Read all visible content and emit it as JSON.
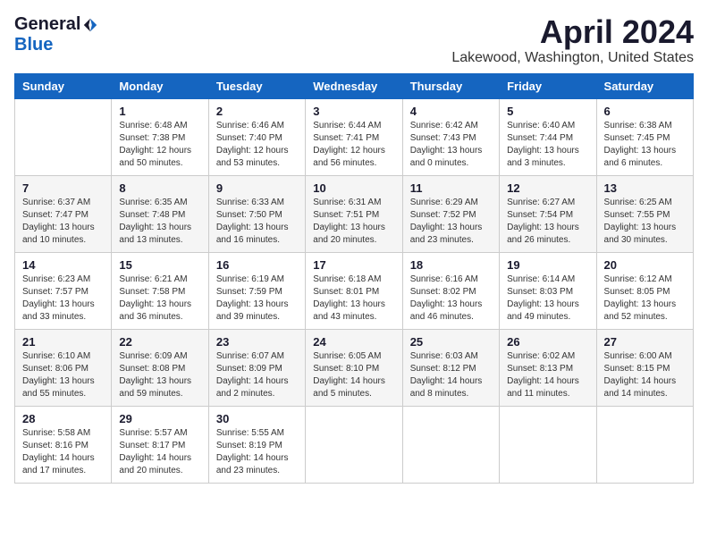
{
  "header": {
    "logo_general": "General",
    "logo_blue": "Blue",
    "month_title": "April 2024",
    "location": "Lakewood, Washington, United States"
  },
  "days_of_week": [
    "Sunday",
    "Monday",
    "Tuesday",
    "Wednesday",
    "Thursday",
    "Friday",
    "Saturday"
  ],
  "weeks": [
    [
      {
        "num": "",
        "info": ""
      },
      {
        "num": "1",
        "info": "Sunrise: 6:48 AM\nSunset: 7:38 PM\nDaylight: 12 hours\nand 50 minutes."
      },
      {
        "num": "2",
        "info": "Sunrise: 6:46 AM\nSunset: 7:40 PM\nDaylight: 12 hours\nand 53 minutes."
      },
      {
        "num": "3",
        "info": "Sunrise: 6:44 AM\nSunset: 7:41 PM\nDaylight: 12 hours\nand 56 minutes."
      },
      {
        "num": "4",
        "info": "Sunrise: 6:42 AM\nSunset: 7:43 PM\nDaylight: 13 hours\nand 0 minutes."
      },
      {
        "num": "5",
        "info": "Sunrise: 6:40 AM\nSunset: 7:44 PM\nDaylight: 13 hours\nand 3 minutes."
      },
      {
        "num": "6",
        "info": "Sunrise: 6:38 AM\nSunset: 7:45 PM\nDaylight: 13 hours\nand 6 minutes."
      }
    ],
    [
      {
        "num": "7",
        "info": "Sunrise: 6:37 AM\nSunset: 7:47 PM\nDaylight: 13 hours\nand 10 minutes."
      },
      {
        "num": "8",
        "info": "Sunrise: 6:35 AM\nSunset: 7:48 PM\nDaylight: 13 hours\nand 13 minutes."
      },
      {
        "num": "9",
        "info": "Sunrise: 6:33 AM\nSunset: 7:50 PM\nDaylight: 13 hours\nand 16 minutes."
      },
      {
        "num": "10",
        "info": "Sunrise: 6:31 AM\nSunset: 7:51 PM\nDaylight: 13 hours\nand 20 minutes."
      },
      {
        "num": "11",
        "info": "Sunrise: 6:29 AM\nSunset: 7:52 PM\nDaylight: 13 hours\nand 23 minutes."
      },
      {
        "num": "12",
        "info": "Sunrise: 6:27 AM\nSunset: 7:54 PM\nDaylight: 13 hours\nand 26 minutes."
      },
      {
        "num": "13",
        "info": "Sunrise: 6:25 AM\nSunset: 7:55 PM\nDaylight: 13 hours\nand 30 minutes."
      }
    ],
    [
      {
        "num": "14",
        "info": "Sunrise: 6:23 AM\nSunset: 7:57 PM\nDaylight: 13 hours\nand 33 minutes."
      },
      {
        "num": "15",
        "info": "Sunrise: 6:21 AM\nSunset: 7:58 PM\nDaylight: 13 hours\nand 36 minutes."
      },
      {
        "num": "16",
        "info": "Sunrise: 6:19 AM\nSunset: 7:59 PM\nDaylight: 13 hours\nand 39 minutes."
      },
      {
        "num": "17",
        "info": "Sunrise: 6:18 AM\nSunset: 8:01 PM\nDaylight: 13 hours\nand 43 minutes."
      },
      {
        "num": "18",
        "info": "Sunrise: 6:16 AM\nSunset: 8:02 PM\nDaylight: 13 hours\nand 46 minutes."
      },
      {
        "num": "19",
        "info": "Sunrise: 6:14 AM\nSunset: 8:03 PM\nDaylight: 13 hours\nand 49 minutes."
      },
      {
        "num": "20",
        "info": "Sunrise: 6:12 AM\nSunset: 8:05 PM\nDaylight: 13 hours\nand 52 minutes."
      }
    ],
    [
      {
        "num": "21",
        "info": "Sunrise: 6:10 AM\nSunset: 8:06 PM\nDaylight: 13 hours\nand 55 minutes."
      },
      {
        "num": "22",
        "info": "Sunrise: 6:09 AM\nSunset: 8:08 PM\nDaylight: 13 hours\nand 59 minutes."
      },
      {
        "num": "23",
        "info": "Sunrise: 6:07 AM\nSunset: 8:09 PM\nDaylight: 14 hours\nand 2 minutes."
      },
      {
        "num": "24",
        "info": "Sunrise: 6:05 AM\nSunset: 8:10 PM\nDaylight: 14 hours\nand 5 minutes."
      },
      {
        "num": "25",
        "info": "Sunrise: 6:03 AM\nSunset: 8:12 PM\nDaylight: 14 hours\nand 8 minutes."
      },
      {
        "num": "26",
        "info": "Sunrise: 6:02 AM\nSunset: 8:13 PM\nDaylight: 14 hours\nand 11 minutes."
      },
      {
        "num": "27",
        "info": "Sunrise: 6:00 AM\nSunset: 8:15 PM\nDaylight: 14 hours\nand 14 minutes."
      }
    ],
    [
      {
        "num": "28",
        "info": "Sunrise: 5:58 AM\nSunset: 8:16 PM\nDaylight: 14 hours\nand 17 minutes."
      },
      {
        "num": "29",
        "info": "Sunrise: 5:57 AM\nSunset: 8:17 PM\nDaylight: 14 hours\nand 20 minutes."
      },
      {
        "num": "30",
        "info": "Sunrise: 5:55 AM\nSunset: 8:19 PM\nDaylight: 14 hours\nand 23 minutes."
      },
      {
        "num": "",
        "info": ""
      },
      {
        "num": "",
        "info": ""
      },
      {
        "num": "",
        "info": ""
      },
      {
        "num": "",
        "info": ""
      }
    ]
  ]
}
